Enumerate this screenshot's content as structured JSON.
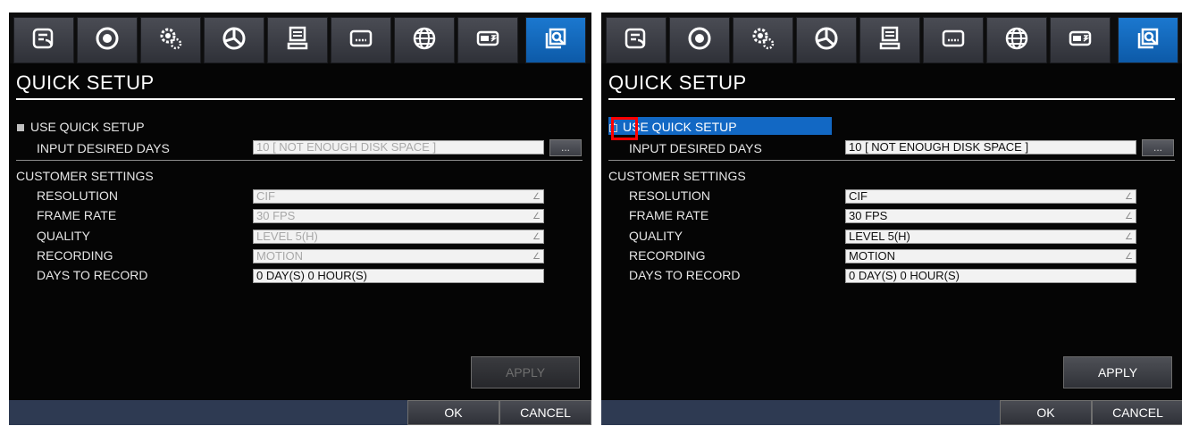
{
  "colors": {
    "accent": "#1268c4",
    "active_tab": "#1b78cf",
    "footer": "#2e3a52",
    "highlight": "#ff0000"
  },
  "toolbar_icons": [
    "hand-list-icon",
    "record-circle-icon",
    "gear-icon",
    "pie-chart-icon",
    "storage-icon",
    "keyboard-icon",
    "globe-icon",
    "device-toggle-icon",
    "quick-search-icon"
  ],
  "panels": [
    {
      "title": "QUICK SETUP",
      "use_quick_setup": {
        "label": "USE QUICK SETUP",
        "checked": false
      },
      "input_desired_days": {
        "label": "INPUT DESIRED DAYS",
        "value": "10 [ NOT ENOUGH DISK SPACE ]",
        "button": "..."
      },
      "customer_settings": "CUSTOMER SETTINGS",
      "resolution": {
        "label": "RESOLUTION",
        "value": "CIF"
      },
      "frame_rate": {
        "label": "FRAME RATE",
        "value": "30 FPS"
      },
      "quality": {
        "label": "QUALITY",
        "value": "LEVEL 5(H)"
      },
      "recording": {
        "label": "RECORDING",
        "value": "MOTION"
      },
      "days_to_record": {
        "label": "DAYS TO RECORD",
        "value": "0 DAY(S) 0 HOUR(S)"
      },
      "apply": "APPLY",
      "ok": "OK",
      "cancel": "CANCEL"
    },
    {
      "title": "QUICK SETUP",
      "use_quick_setup": {
        "label": "USE QUICK SETUP",
        "checked": true
      },
      "input_desired_days": {
        "label": "INPUT DESIRED DAYS",
        "value": "10 [ NOT ENOUGH DISK SPACE ]",
        "button": "..."
      },
      "customer_settings": "CUSTOMER SETTINGS",
      "resolution": {
        "label": "RESOLUTION",
        "value": "CIF"
      },
      "frame_rate": {
        "label": "FRAME RATE",
        "value": "30 FPS"
      },
      "quality": {
        "label": "QUALITY",
        "value": "LEVEL 5(H)"
      },
      "recording": {
        "label": "RECORDING",
        "value": "MOTION"
      },
      "days_to_record": {
        "label": "DAYS TO RECORD",
        "value": "0 DAY(S) 0 HOUR(S)"
      },
      "apply": "APPLY",
      "ok": "OK",
      "cancel": "CANCEL"
    }
  ]
}
